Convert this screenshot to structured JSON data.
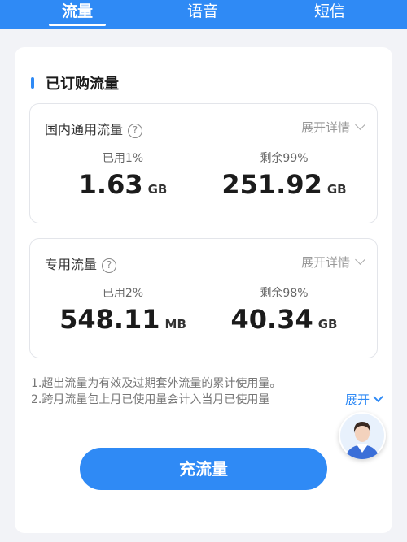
{
  "tabs": [
    {
      "label": "流量",
      "active": true
    },
    {
      "label": "语音",
      "active": false
    },
    {
      "label": "短信",
      "active": false
    }
  ],
  "section": {
    "title": "已订购流量"
  },
  "cards": [
    {
      "title": "国内通用流量",
      "expand_label": "展开详情",
      "used": {
        "label": "已用1%",
        "value": "1.63",
        "unit": "GB"
      },
      "remaining": {
        "label": "剩余99%",
        "value": "251.92",
        "unit": "GB"
      }
    },
    {
      "title": "专用流量",
      "expand_label": "展开详情",
      "used": {
        "label": "已用2%",
        "value": "548.11",
        "unit": "MB"
      },
      "remaining": {
        "label": "剩余98%",
        "value": "40.34",
        "unit": "GB"
      }
    }
  ],
  "notes": {
    "line1": "1.超出流量为有效及过期套外流量的累计使用量。",
    "line2": "2.跨月流量包上月已使用量会计入当月已使用量",
    "expand_label": "展开"
  },
  "recharge_button": "充流量",
  "colors": {
    "accent": "#2f8af5",
    "background": "#f2f3f7"
  },
  "icons": {
    "help": "question-circle-icon",
    "expand": "chevron-down-icon",
    "assistant": "assistant-avatar-icon"
  }
}
